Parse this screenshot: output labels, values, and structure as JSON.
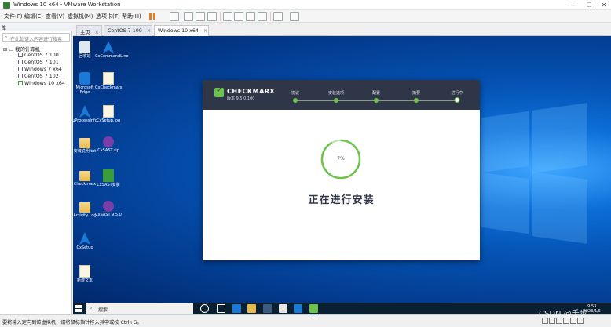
{
  "window": {
    "title": "Windows 10 x64 - VMware Workstation",
    "controls": [
      "—",
      "☐",
      "✕"
    ]
  },
  "menu": [
    "文件(F)",
    "编辑(E)",
    "查看(V)",
    "虚拟机(M)",
    "选项卡(T)",
    "帮助(H)"
  ],
  "library": {
    "header": "库",
    "close": "×",
    "search_placeholder": "在此处键入内容进行搜索",
    "root": "我的计算机",
    "vms": [
      "CentOS 7 100",
      "CentOS 7 101",
      "Windows 7 x64",
      "CentOS 7 102",
      "Windows 10 x64"
    ]
  },
  "tabs": [
    {
      "label": "主页",
      "close": "×"
    },
    {
      "label": "CentOS 7 100",
      "close": "×"
    },
    {
      "label": "Windows 10 x64",
      "close": "×"
    }
  ],
  "desktop_icons": [
    {
      "label": "回收站",
      "kind": "bin"
    },
    {
      "label": "CxCommandLine",
      "kind": "arrow"
    },
    {
      "label": "Microsoft Edge",
      "kind": "edge"
    },
    {
      "label": "CxCheckmarx",
      "kind": "doc"
    },
    {
      "label": "uProcessInfo",
      "kind": "arrow"
    },
    {
      "label": "CxSetup.log",
      "kind": "doc"
    },
    {
      "label": "安装说明.txt",
      "kind": "folder"
    },
    {
      "label": "CxSAST.zip",
      "kind": "rar"
    },
    {
      "label": "Checkmarx",
      "kind": "folder"
    },
    {
      "label": "CxSAST安装",
      "kind": "green"
    },
    {
      "label": "Activity Log",
      "kind": "folder"
    },
    {
      "label": "CxSAST 9.5.0",
      "kind": "rar"
    },
    {
      "label": "CxSetup",
      "kind": "arrow"
    },
    {
      "label": "新建文本",
      "kind": "doc"
    }
  ],
  "installer": {
    "brand": "CHECKMARX",
    "version": "版本 9.5.0.100",
    "steps": [
      "协议",
      "安装选项",
      "配置",
      "摘要",
      "进行中"
    ],
    "progress_percent": 7,
    "progress_text": "7%",
    "status": "正在进行安装"
  },
  "taskbar": {
    "search_placeholder": "搜索",
    "time": "9:53",
    "date": "2023/1/5"
  },
  "statusbar": {
    "message": "要将输入定向到该虚拟机，请将鼠标指针移入其中或按 Ctrl+G。"
  },
  "watermark": "CSDN @千步",
  "colors": {
    "installer_header": "#2f3647",
    "accent_green": "#6cc24a",
    "pause_orange": "#e37b1f"
  }
}
